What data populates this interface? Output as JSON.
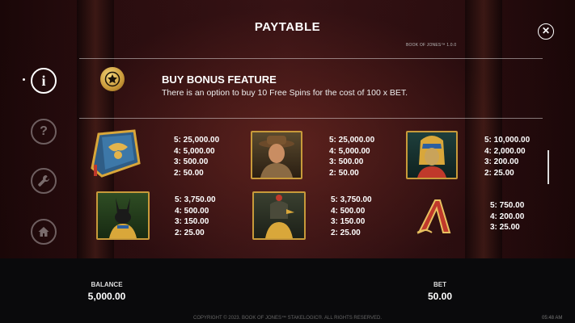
{
  "header": {
    "title": "PAYTABLE",
    "version": "BOOK OF JONES™ 1.0.0"
  },
  "close_icon": "✕",
  "sidebar": {
    "items": [
      {
        "name": "info",
        "glyph": "i"
      },
      {
        "name": "help",
        "glyph": "?"
      },
      {
        "name": "settings",
        "glyph": "🔧"
      },
      {
        "name": "home",
        "glyph": "⌂"
      }
    ]
  },
  "bonus": {
    "title": "BUY BONUS FEATURE",
    "description": "There is an option to buy 10 Free Spins for the cost of 100 x BET."
  },
  "symbols": [
    {
      "name": "book",
      "pays": [
        "5: 25,000.00",
        "4: 5,000.00",
        "3: 500.00",
        "2: 50.00"
      ]
    },
    {
      "name": "explorer",
      "pays": [
        "5: 25,000.00",
        "4: 5,000.00",
        "3: 500.00",
        "2: 50.00"
      ]
    },
    {
      "name": "pharaoh",
      "pays": [
        "5: 10,000.00",
        "4: 2,000.00",
        "3: 200.00",
        "2: 25.00"
      ]
    },
    {
      "name": "anubis",
      "pays": [
        "5: 3,750.00",
        "4: 500.00",
        "3: 150.00",
        "2: 25.00"
      ]
    },
    {
      "name": "horus",
      "pays": [
        "5: 3,750.00",
        "4: 500.00",
        "3: 150.00",
        "2: 25.00"
      ]
    },
    {
      "name": "letter-a",
      "pays": [
        "5: 750.00",
        "4: 200.00",
        "3: 25.00"
      ]
    }
  ],
  "footer_bar": {
    "balance_label": "BALANCE",
    "balance_value": "5,000.00",
    "bet_label": "BET",
    "bet_value": "50.00"
  },
  "copyright": "COPYRIGHT © 2023. BOOK OF JONES™ STAKELOGIC®. ALL RIGHTS RESERVED.",
  "clock": "05:48 AM"
}
